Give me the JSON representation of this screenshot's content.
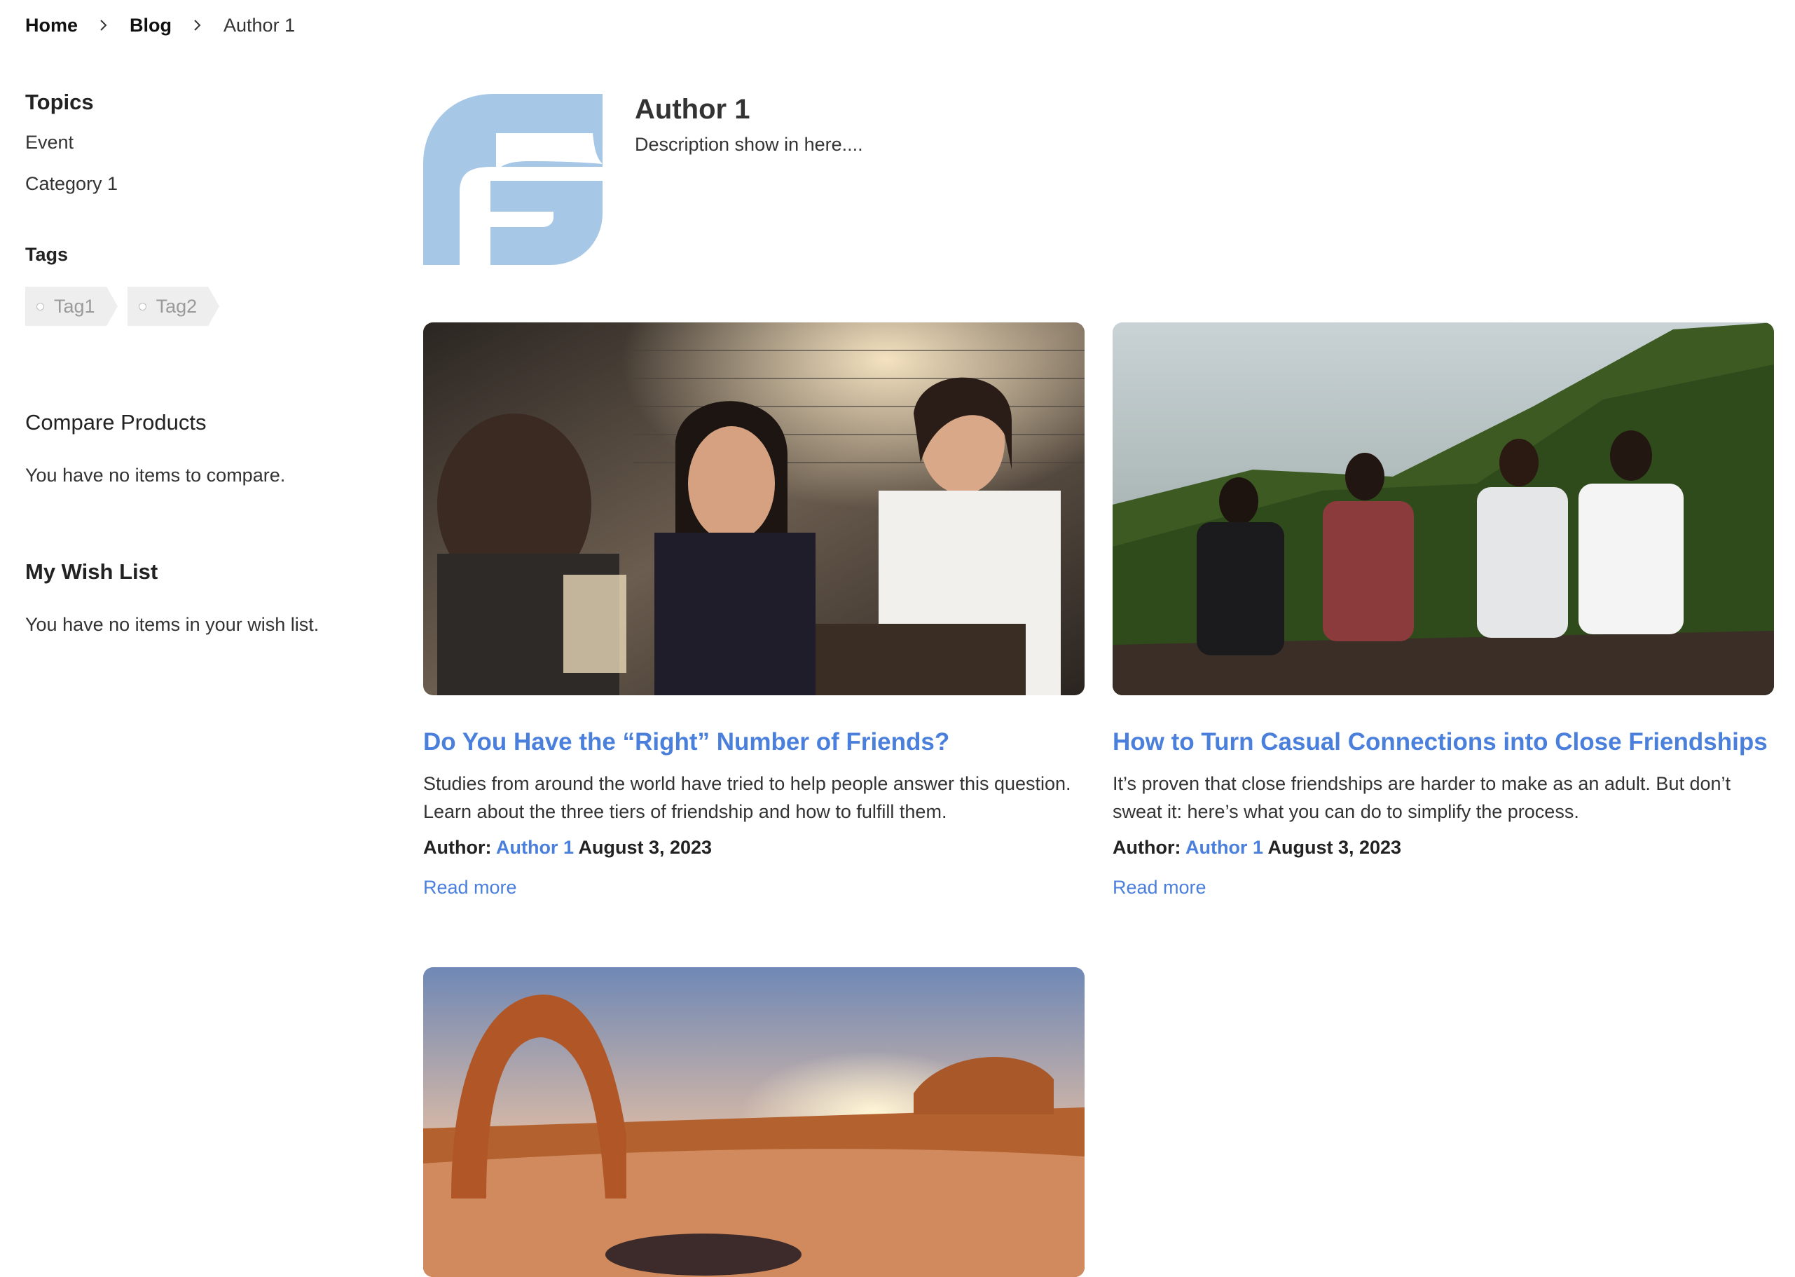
{
  "breadcrumb": {
    "home": "Home",
    "blog": "Blog",
    "current": "Author 1"
  },
  "sidebar": {
    "topics_heading": "Topics",
    "topics": [
      "Event",
      "Category 1"
    ],
    "tags_heading": "Tags",
    "tags": [
      "Tag1",
      "Tag2"
    ],
    "compare_heading": "Compare Products",
    "compare_text": "You have no items to compare.",
    "wishlist_heading": "My Wish List",
    "wishlist_text": "You have no items in your wish list."
  },
  "author": {
    "name": "Author 1",
    "description": "Description show in here....",
    "logo_color": "#a7c7e7"
  },
  "posts": [
    {
      "title": "Do You Have the “Right” Number of Friends?",
      "excerpt": "Studies from around the world have tried to help people answer this question. Learn about the three tiers of friendship and how to fulfill them.",
      "author_label": "Author:",
      "author": "Author 1",
      "date": "August 3, 2023",
      "read_more": "Read more",
      "image": "friends-at-restaurant-photo"
    },
    {
      "title": "How to Turn Casual Connections into Close Friendships",
      "excerpt": "It’s proven that close friendships are harder to make as an adult. But don’t sweat it: here’s what you can do to simplify the process.",
      "author_label": "Author:",
      "author": "Author 1",
      "date": "August 3, 2023",
      "read_more": "Read more",
      "image": "friends-on-mountain-photo"
    },
    {
      "image": "desert-arch-sunset-photo"
    }
  ],
  "colors": {
    "link": "#4a7fdc",
    "text": "#333333",
    "tag_bg": "#eeeeee"
  }
}
